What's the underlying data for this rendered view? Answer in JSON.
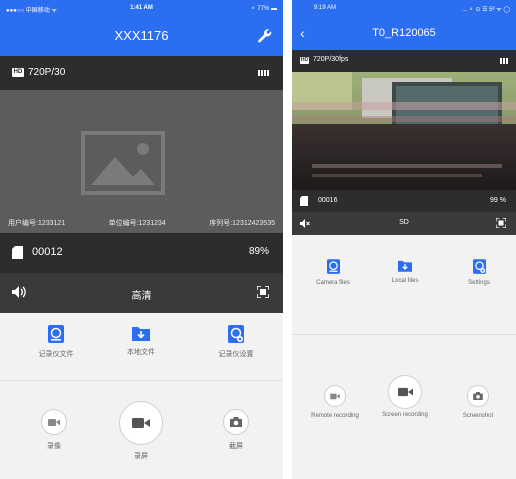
{
  "left": {
    "statusbar": {
      "carrier": "●●●○○ 中国移动 ᯤ",
      "time": "1:41 AM",
      "battery": "⚬ 77% ▬"
    },
    "title": "XXX1176",
    "topbar": {
      "hd": "HD",
      "resolution": "720P/30"
    },
    "overlay": {
      "user_id": "用户编号:1233121",
      "unit_id": "单位编号:1231234",
      "serial": "序列号:12312423535"
    },
    "storage": {
      "count": "00012",
      "percent": "89%"
    },
    "controls": {
      "quality": "高清"
    },
    "files": [
      {
        "label": "记录仪文件",
        "icon": "camera-files-icon"
      },
      {
        "label": "本地文件",
        "icon": "local-files-icon"
      },
      {
        "label": "记录仪设置",
        "icon": "settings-icon"
      }
    ],
    "record": [
      {
        "label": "录像",
        "icon": "video-camera-icon"
      },
      {
        "label": "录屏",
        "icon": "video-camera-icon"
      },
      {
        "label": "截屏",
        "icon": "camera-icon"
      }
    ],
    "colors": {
      "accent": "#2b6ff0",
      "bar_dark": "#2d2d2d",
      "video_gray": "#5c5c5c"
    }
  },
  "right": {
    "statusbar": {
      "time": "9:19 AM",
      "icons": "... ⚬ ⊙ ☰ 5ᴵᴵ ᯤ ◯"
    },
    "title": "T0_R120065",
    "topbar": {
      "hd": "HD",
      "resolution": "720P/30fps"
    },
    "storage": {
      "count": "00016",
      "percent": "99 %"
    },
    "controls": {
      "quality": "SD"
    },
    "files": [
      {
        "label": "Camera files",
        "icon": "camera-files-icon"
      },
      {
        "label": "Local files",
        "icon": "local-files-icon"
      },
      {
        "label": "Settings",
        "icon": "settings-icon"
      }
    ],
    "record": [
      {
        "label": "Remote recording",
        "icon": "video-camera-icon"
      },
      {
        "label": "Screen recording",
        "icon": "video-camera-icon"
      },
      {
        "label": "Screenshot",
        "icon": "camera-icon"
      }
    ]
  }
}
